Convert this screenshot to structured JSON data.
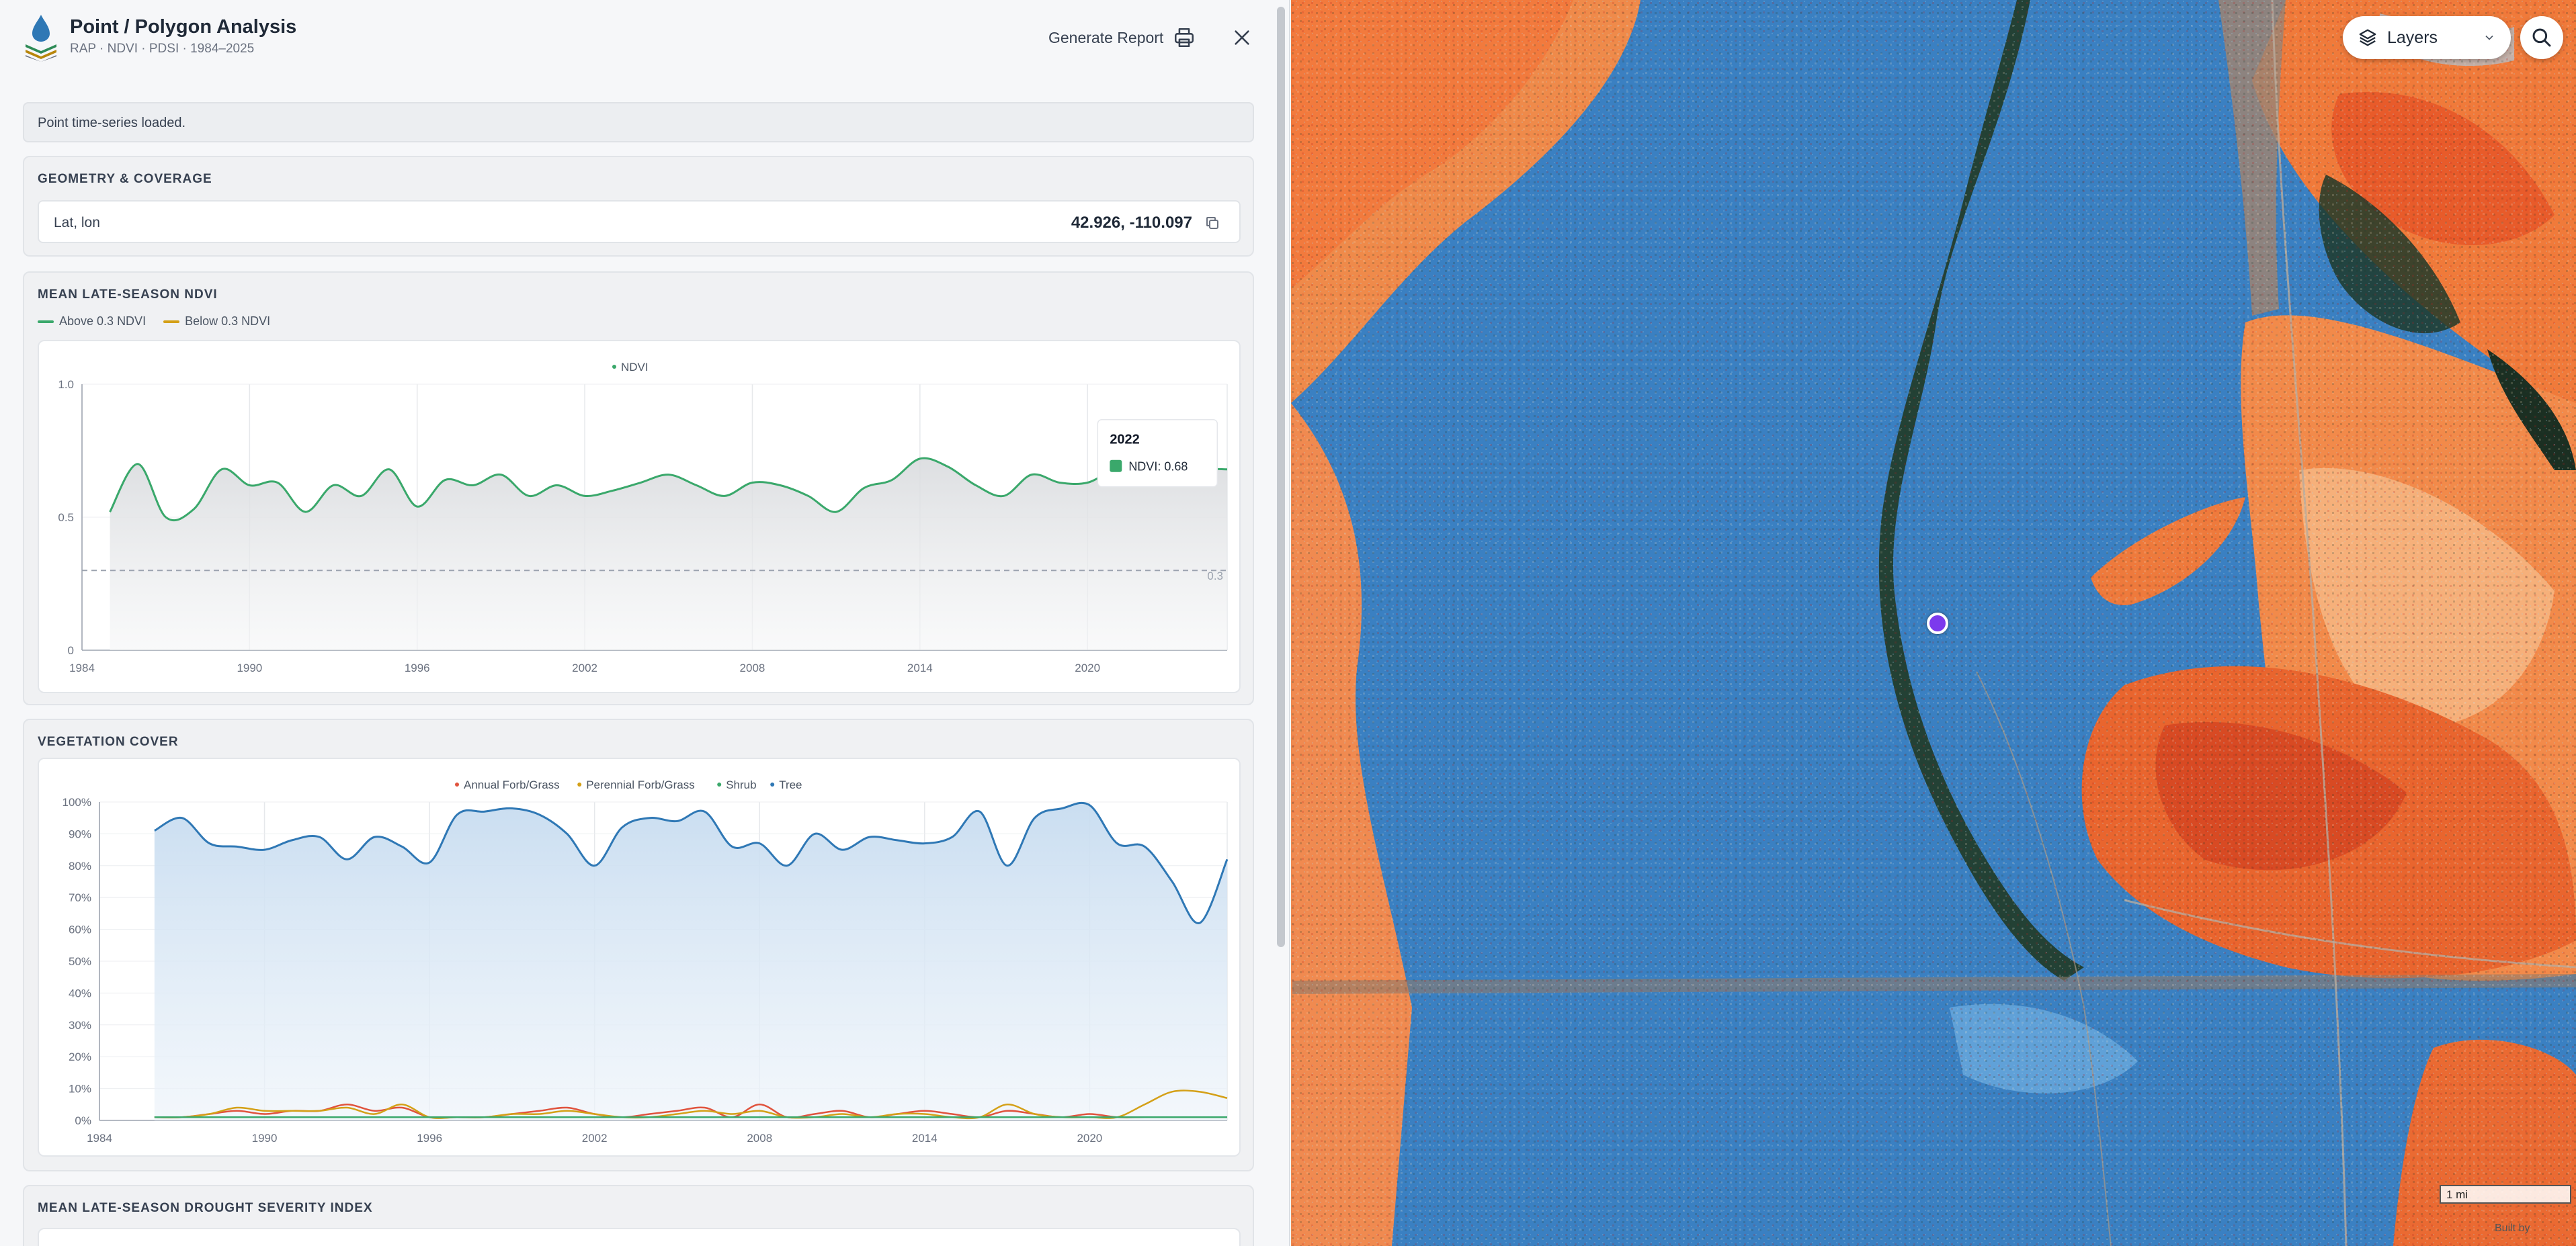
{
  "app": {
    "title": "Point / Polygon Analysis",
    "subtitle": "RAP · NDVI · PDSI · 1984–2025"
  },
  "header": {
    "generate_report_label": "Generate Report"
  },
  "status": {
    "message": "Point time-series loaded."
  },
  "geometry": {
    "section_title": "GEOMETRY & COVERAGE",
    "latlon_label": "Lat, lon",
    "latlon_value": "42.926, -110.097"
  },
  "ndvi_section": {
    "title": "MEAN LATE-SEASON NDVI",
    "legend": [
      {
        "label": "Above 0.3 NDVI",
        "color": "#3aa86b"
      },
      {
        "label": "Below 0.3 NDVI",
        "color": "#d4a017"
      }
    ],
    "tooltip": {
      "year": "2022",
      "label": "NDVI: 0.68"
    }
  },
  "cover_section": {
    "title": "VEGETATION COVER"
  },
  "drought_section": {
    "title": "MEAN LATE-SEASON DROUGHT SEVERITY INDEX"
  },
  "map": {
    "layers_label": "Layers",
    "scale_label": "1 mi",
    "attribution": "Built by"
  },
  "colors": {
    "ndvi_line": "#3aa86b",
    "tree_line": "#2f78b5",
    "annual_line": "#e0533d",
    "perennial_line": "#d4a017",
    "shrub_line": "#3aa86b",
    "marker": "#7c3aed"
  },
  "chart_data": [
    {
      "type": "line",
      "legend_series": "NDVI",
      "x": [
        1985,
        1986,
        1987,
        1988,
        1989,
        1990,
        1991,
        1992,
        1993,
        1994,
        1995,
        1996,
        1997,
        1998,
        1999,
        2000,
        2001,
        2002,
        2003,
        2004,
        2005,
        2006,
        2007,
        2008,
        2009,
        2010,
        2011,
        2012,
        2013,
        2014,
        2015,
        2016,
        2017,
        2018,
        2019,
        2020,
        2021,
        2022,
        2023,
        2024,
        2025
      ],
      "series": [
        {
          "name": "NDVI",
          "values": [
            0.52,
            0.7,
            0.5,
            0.53,
            0.68,
            0.62,
            0.63,
            0.52,
            0.62,
            0.58,
            0.68,
            0.54,
            0.64,
            0.62,
            0.66,
            0.58,
            0.62,
            0.58,
            0.6,
            0.63,
            0.66,
            0.62,
            0.58,
            0.63,
            0.62,
            0.58,
            0.52,
            0.61,
            0.64,
            0.72,
            0.69,
            0.62,
            0.58,
            0.66,
            0.63,
            0.63,
            0.68,
            0.68,
            0.66,
            0.68,
            0.68
          ]
        }
      ],
      "threshold": {
        "value": 0.3,
        "label": "0.3"
      },
      "y_ticks": [
        "0",
        "0.5",
        "1.0"
      ],
      "x_ticks": [
        "1984",
        "1990",
        "1996",
        "2002",
        "2008",
        "2014",
        "2020"
      ],
      "ylim": [
        0,
        1.0
      ],
      "xlim": [
        1984,
        2025
      ]
    },
    {
      "type": "line",
      "x": [
        1986,
        1987,
        1988,
        1989,
        1990,
        1991,
        1992,
        1993,
        1994,
        1995,
        1996,
        1997,
        1998,
        1999,
        2000,
        2001,
        2002,
        2003,
        2004,
        2005,
        2006,
        2007,
        2008,
        2009,
        2010,
        2011,
        2012,
        2013,
        2014,
        2015,
        2016,
        2017,
        2018,
        2019,
        2020,
        2021,
        2022,
        2023,
        2024,
        2025
      ],
      "series": [
        {
          "name": "Annual Forb/Grass",
          "values": [
            1,
            1,
            2,
            3,
            2,
            3,
            3,
            5,
            3,
            4,
            1,
            1,
            1,
            2,
            3,
            4,
            2,
            1,
            2,
            3,
            4,
            1,
            5,
            1,
            2,
            3,
            1,
            2,
            3,
            2,
            1,
            3,
            2,
            1,
            2,
            1,
            1,
            1,
            1,
            1
          ]
        },
        {
          "name": "Perennial Forb/Grass",
          "values": [
            1,
            1,
            2,
            4,
            3,
            3,
            3,
            4,
            2,
            5,
            1,
            1,
            1,
            2,
            2,
            3,
            2,
            1,
            1,
            2,
            3,
            2,
            3,
            1,
            1,
            2,
            1,
            2,
            2,
            1,
            1,
            5,
            2,
            1,
            1,
            1,
            5,
            9,
            9,
            7
          ]
        },
        {
          "name": "Shrub",
          "values": [
            1,
            1,
            1,
            1,
            1,
            1,
            1,
            1,
            1,
            1,
            1,
            1,
            1,
            1,
            1,
            1,
            1,
            1,
            1,
            1,
            1,
            1,
            1,
            1,
            1,
            1,
            1,
            1,
            1,
            1,
            1,
            1,
            1,
            1,
            1,
            1,
            1,
            1,
            1,
            1
          ]
        },
        {
          "name": "Tree",
          "values": [
            91,
            95,
            87,
            86,
            85,
            88,
            89,
            82,
            89,
            86,
            81,
            96,
            97,
            98,
            96,
            90,
            80,
            92,
            95,
            94,
            97,
            86,
            87,
            80,
            90,
            85,
            89,
            88,
            87,
            89,
            97,
            80,
            95,
            98,
            99,
            87,
            86,
            75,
            62,
            82
          ]
        }
      ],
      "y_ticks": [
        "0%",
        "10%",
        "20%",
        "30%",
        "40%",
        "50%",
        "60%",
        "70%",
        "80%",
        "90%",
        "100%"
      ],
      "x_ticks": [
        "1984",
        "1990",
        "1996",
        "2002",
        "2008",
        "2014",
        "2020"
      ],
      "ylim": [
        0,
        100
      ],
      "xlim": [
        1984,
        2025
      ]
    }
  ]
}
